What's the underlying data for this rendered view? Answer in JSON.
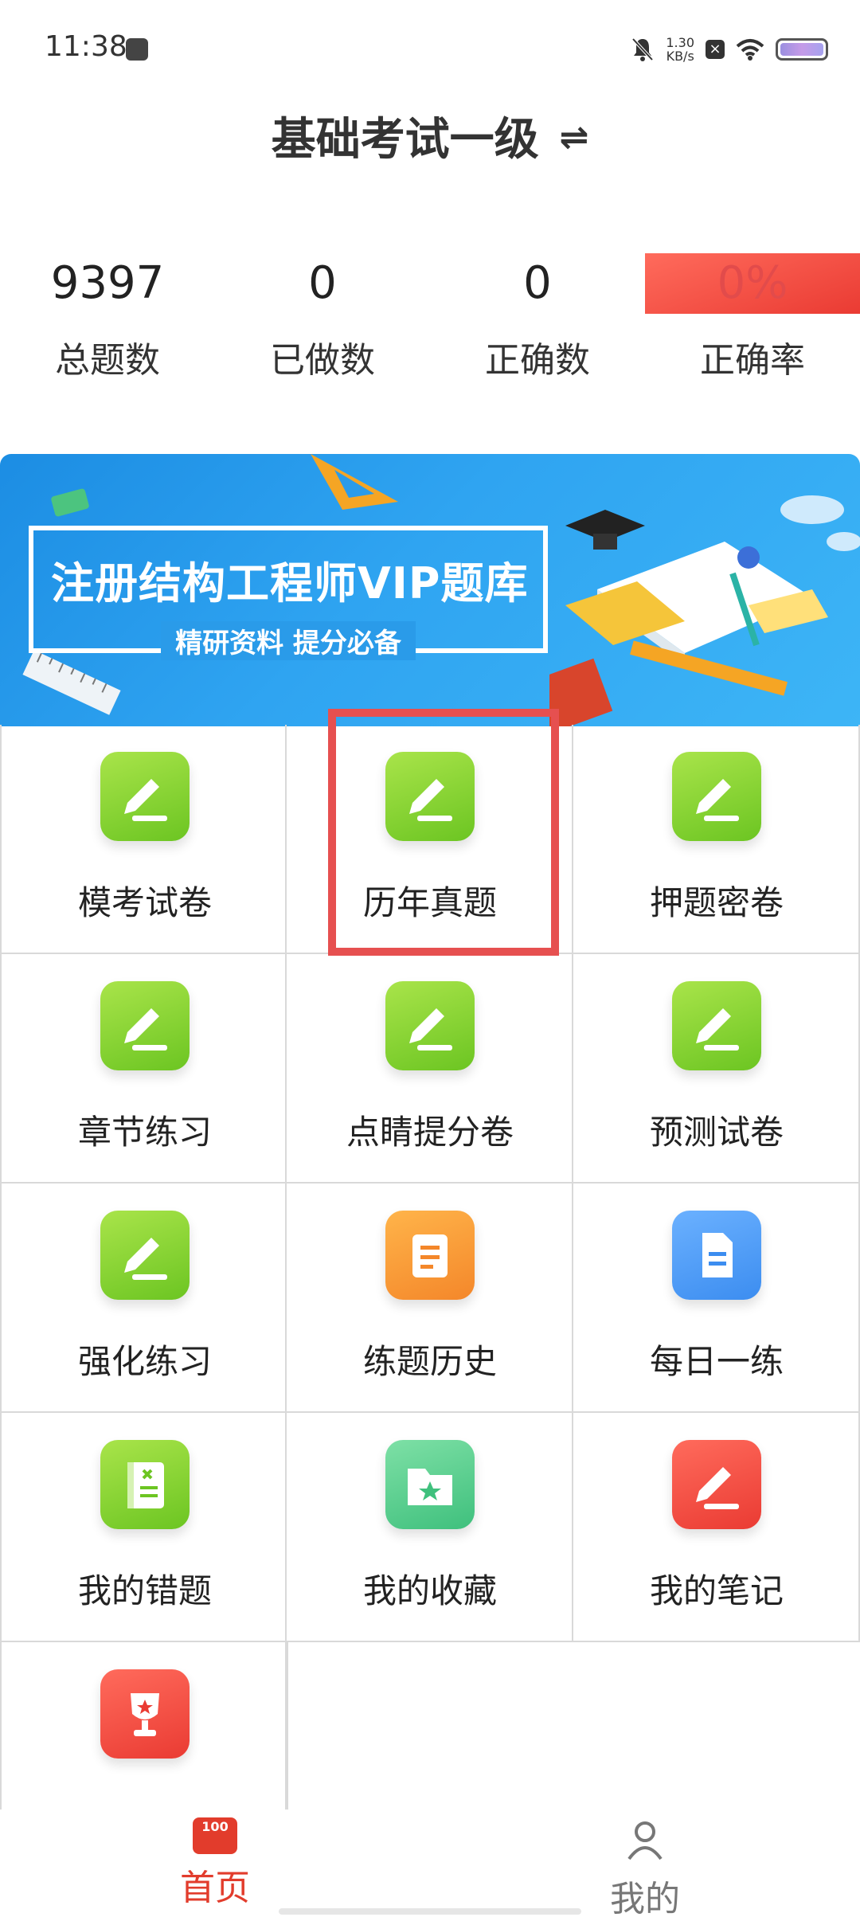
{
  "status_bar": {
    "time": "11:38",
    "net_speed_value": "1.30",
    "net_speed_unit": "KB/s"
  },
  "header": {
    "title": "基础考试一级",
    "switch_glyph": "⇌"
  },
  "stats": [
    {
      "value": "9397",
      "label": "总题数"
    },
    {
      "value": "0",
      "label": "已做数"
    },
    {
      "value": "0",
      "label": "正确数"
    },
    {
      "value": "0%",
      "label": "正确率"
    }
  ],
  "banner": {
    "title": "注册结构工程师VIP题库",
    "subtitle": "精研资料  提分必备"
  },
  "menu": [
    {
      "label": "模考试卷",
      "icon": "pencil-icon",
      "color": "green"
    },
    {
      "label": "历年真题",
      "icon": "pencil-icon",
      "color": "green"
    },
    {
      "label": "押题密卷",
      "icon": "pencil-icon",
      "color": "green"
    },
    {
      "label": "章节练习",
      "icon": "pencil-icon",
      "color": "green"
    },
    {
      "label": "点睛提分卷",
      "icon": "pencil-icon",
      "color": "green"
    },
    {
      "label": "预测试卷",
      "icon": "pencil-icon",
      "color": "green"
    },
    {
      "label": "强化练习",
      "icon": "pencil-icon",
      "color": "green"
    },
    {
      "label": "练题历史",
      "icon": "scroll-icon",
      "color": "orange"
    },
    {
      "label": "每日一练",
      "icon": "document-icon",
      "color": "blue"
    },
    {
      "label": "我的错题",
      "icon": "error-book-icon",
      "color": "green"
    },
    {
      "label": "我的收藏",
      "icon": "star-folder-icon",
      "color": "teal"
    },
    {
      "label": "我的笔记",
      "icon": "pencil-icon",
      "color": "red"
    },
    {
      "label": "",
      "icon": "trophy-icon",
      "color": "red"
    }
  ],
  "bottom_nav": {
    "home_label": "首页",
    "home_icon_text": "100",
    "mine_label": "我的"
  },
  "colors": {
    "accent": "#e23c2c",
    "highlight": "#e65050",
    "green": "#7ccf2c"
  }
}
